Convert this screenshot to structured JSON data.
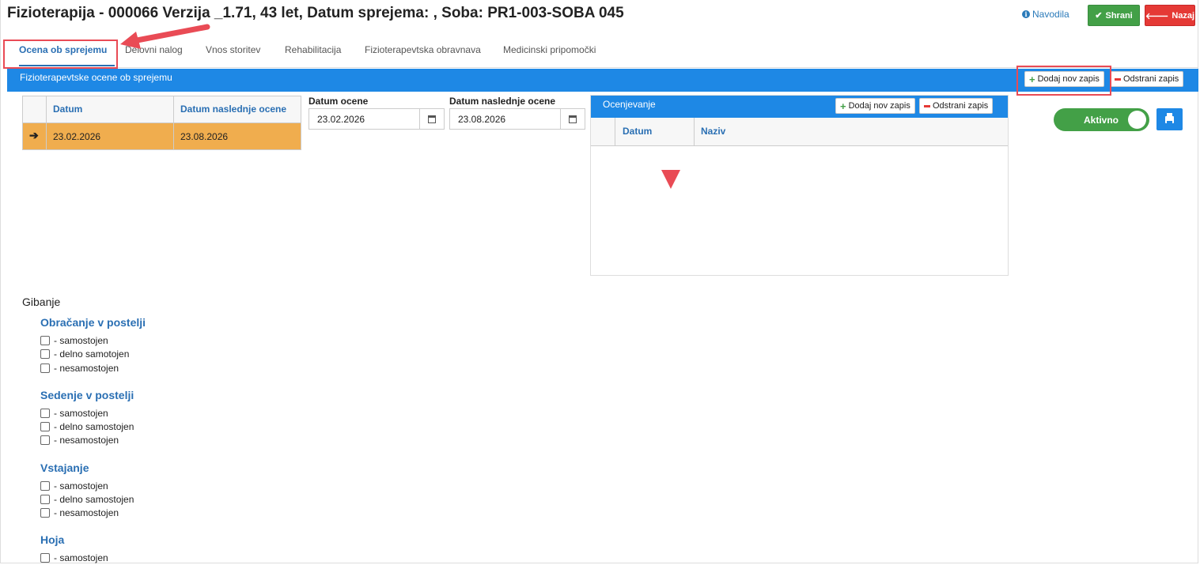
{
  "header": {
    "title": "Fizioterapija - 000066 Verzija _1.71, 43 let, Datum sprejema: , Soba: PR1-003-SOBA 045",
    "help_label": "Navodila",
    "save_label": "Shrani",
    "back_label": "Nazaj"
  },
  "tabs": [
    {
      "label": "Ocena ob sprejemu",
      "active": true
    },
    {
      "label": "Delovni nalog"
    },
    {
      "label": "Vnos storitev"
    },
    {
      "label": "Rehabilitacija"
    },
    {
      "label": "Fizioterapevtska obravnava"
    },
    {
      "label": "Medicinski pripomočki"
    }
  ],
  "section": {
    "title": "Fizioterapevtske ocene ob sprejemu",
    "add_label": "Dodaj nov zapis",
    "remove_label": "Odstrani zapis"
  },
  "grid": {
    "columns": [
      "Datum",
      "Datum naslednje ocene"
    ],
    "rows": [
      {
        "datum": "23.02.2026",
        "naslednja": "23.08.2026",
        "selected": true
      }
    ]
  },
  "form": {
    "datum_ocene_label": "Datum ocene",
    "datum_ocene_value": "23.02.2026",
    "datum_naslednje_label": "Datum naslednje ocene",
    "datum_naslednje_value": "23.08.2026"
  },
  "ocenjevanje": {
    "title": "Ocenjevanje",
    "add_label": "Dodaj nov zapis",
    "remove_label": "Odstrani zapis",
    "columns": [
      "Datum",
      "Naziv"
    ]
  },
  "status": {
    "toggle_label": "Aktivno",
    "toggle_on": true
  },
  "gibanje": {
    "title": "Gibanje",
    "groups": [
      {
        "title": "Obračanje v postelji",
        "options": [
          "- samostojen",
          "- delno samotojen",
          "- nesamostojen"
        ]
      },
      {
        "title": "Sedenje v postelji",
        "options": [
          "- samostojen",
          "- delno samostojen",
          "- nesamostojen"
        ]
      },
      {
        "title": "Vstajanje",
        "options": [
          "- samostojen",
          "- delno samostojen",
          "- nesamostojen"
        ]
      },
      {
        "title": "Hoja",
        "options": [
          "- samostojen"
        ]
      }
    ]
  },
  "colors": {
    "primary": "#1e88e5",
    "link": "#2a6fb3",
    "success": "#43a047",
    "danger": "#e53935",
    "selected_row": "#f0ad4e",
    "annotation": "#e94b55"
  }
}
